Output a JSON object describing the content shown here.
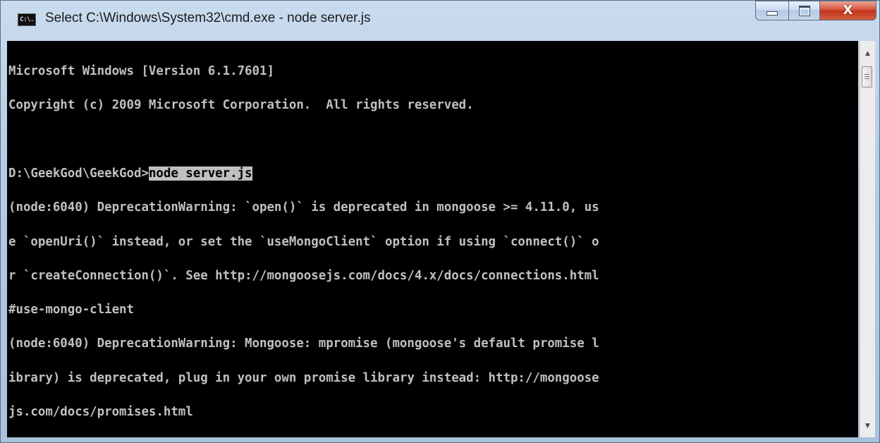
{
  "window": {
    "title": "Select C:\\Windows\\System32\\cmd.exe - node  server.js",
    "icon": "cmd-icon",
    "icon_label": "C:\\."
  },
  "controls": {
    "minimize": "minimize-icon",
    "maximize": "maximize-icon",
    "close": "close-icon",
    "close_glyph": "X"
  },
  "console": {
    "lines": [
      "Microsoft Windows [Version 6.1.7601]",
      "Copyright (c) 2009 Microsoft Corporation.  All rights reserved.",
      "",
      "",
      "(node:6040) DeprecationWarning: `open()` is deprecated in mongoose >= 4.11.0, us",
      "e `openUri()` instead, or set the `useMongoClient` option if using `connect()` o",
      "r `createConnection()`. See http://mongoosejs.com/docs/4.x/docs/connections.html",
      "#use-mongo-client",
      "(node:6040) DeprecationWarning: Mongoose: mpromise (mongoose's default promise l",
      "ibrary) is deprecated, plug in your own promise library instead: http://mongoose",
      "js.com/docs/promises.html"
    ],
    "prompt": "D:\\GeekGod\\GeekGod>",
    "command": "node server.js",
    "colors": {
      "background": "#000000",
      "text": "#c0c0c0",
      "selection": "#c0c0c0"
    }
  },
  "scrollbar": {
    "up_arrow": "scroll-up-icon",
    "down_arrow": "scroll-down-icon",
    "up_glyph": "▲",
    "down_glyph": "▼",
    "position": 0
  }
}
